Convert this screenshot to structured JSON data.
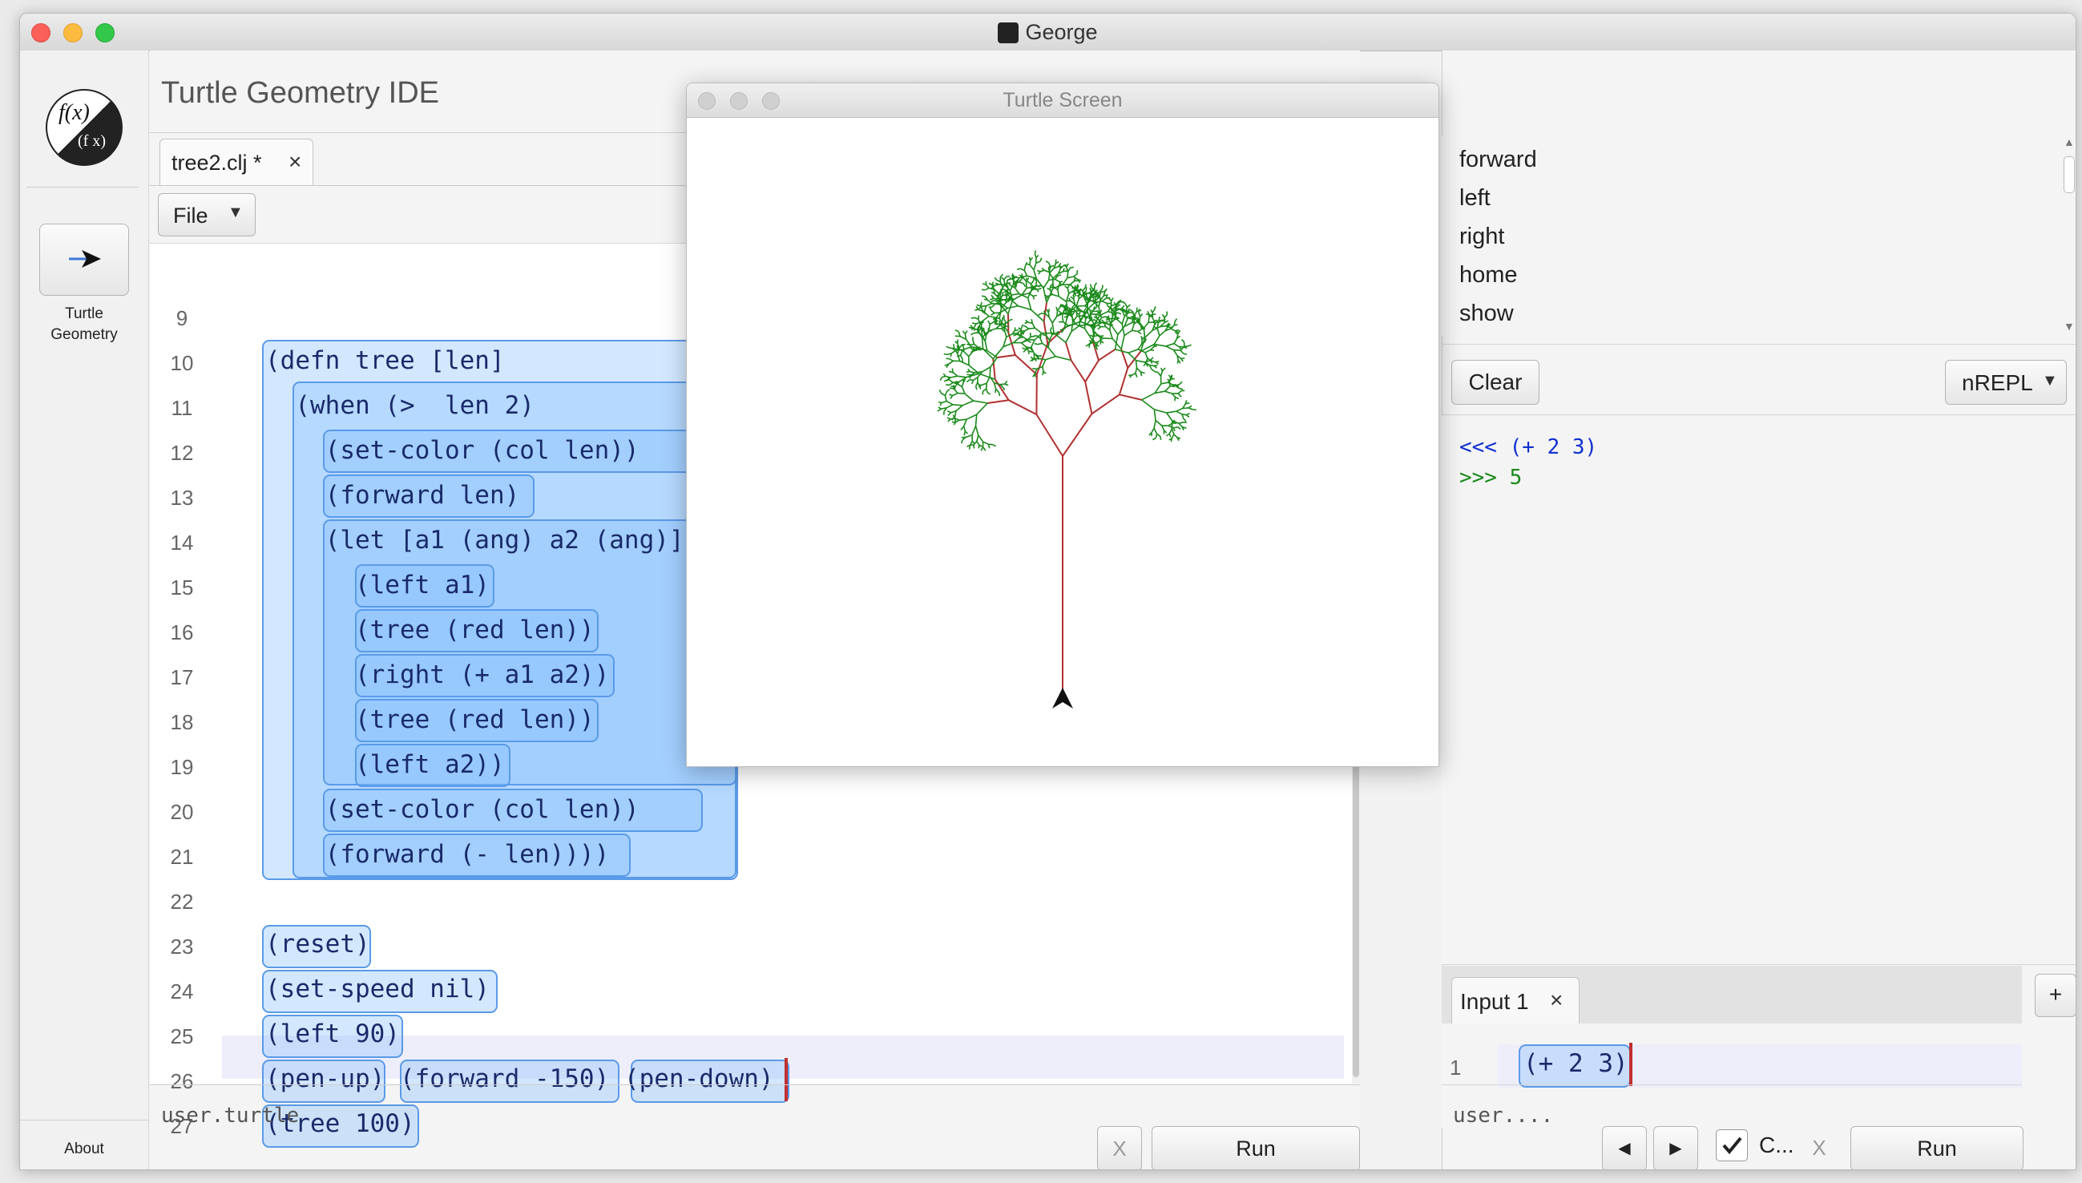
{
  "window": {
    "title": "George"
  },
  "app": {
    "title": "Turtle Geometry IDE"
  },
  "logo": {
    "text_top": "f(x)",
    "text_bottom": "(f x)"
  },
  "leftnav": {
    "turtle_label_line1": "Turtle",
    "turtle_label_line2": "Geometry",
    "about": "About"
  },
  "editor": {
    "tab": "tree2.clj *",
    "file_menu": "File",
    "namespace": "user.turtle",
    "clear_button": "X",
    "run_button": "Run",
    "line_numbers": [
      "9",
      "10",
      "11",
      "12",
      "13",
      "14",
      "15",
      "16",
      "17",
      "18",
      "19",
      "20",
      "21",
      "22",
      "23",
      "24",
      "25",
      "26",
      "27"
    ],
    "lines": [
      "",
      "(defn tree [len]",
      "  (when (>  len 2)",
      "    (set-color (col len))",
      "    (forward len)",
      "    (let [a1 (ang) a2 (ang)]",
      "      (left a1)",
      "      (tree (red len))",
      "      (right (+ a1 a2))",
      "      (tree (red len))",
      "      (left a2))",
      "    (set-color (col len))",
      "    (forward (- len))))",
      "",
      "(reset)",
      "(set-speed nil)",
      "(left 90)",
      "(pen-up) (forward -150) (pen-down)",
      "(tree 100)"
    ]
  },
  "turtle_screen": {
    "title": "Turtle Screen",
    "branch_color": "#b03030",
    "leaf_color": "#1a8a1a"
  },
  "commands": [
    "forward",
    "left",
    "right",
    "home",
    "show"
  ],
  "repl": {
    "clear_button": "Clear",
    "mode": "nREPL",
    "output": [
      {
        "prompt": "<<<",
        "text": "(+ 2 3)",
        "color": "#1030d0"
      },
      {
        "prompt": ">>>",
        "text": "5",
        "color": "#1a8a1a"
      }
    ],
    "input_tab": "Input 1",
    "add_button": "+",
    "input_line_number": "1",
    "input_code": "(+ 2 3)",
    "namespace": "user....",
    "prev_button": "◀",
    "next_button": "▶",
    "checkbox_label": "C...",
    "checkbox_checked": true,
    "clear_x": "X",
    "run_button": "Run"
  }
}
